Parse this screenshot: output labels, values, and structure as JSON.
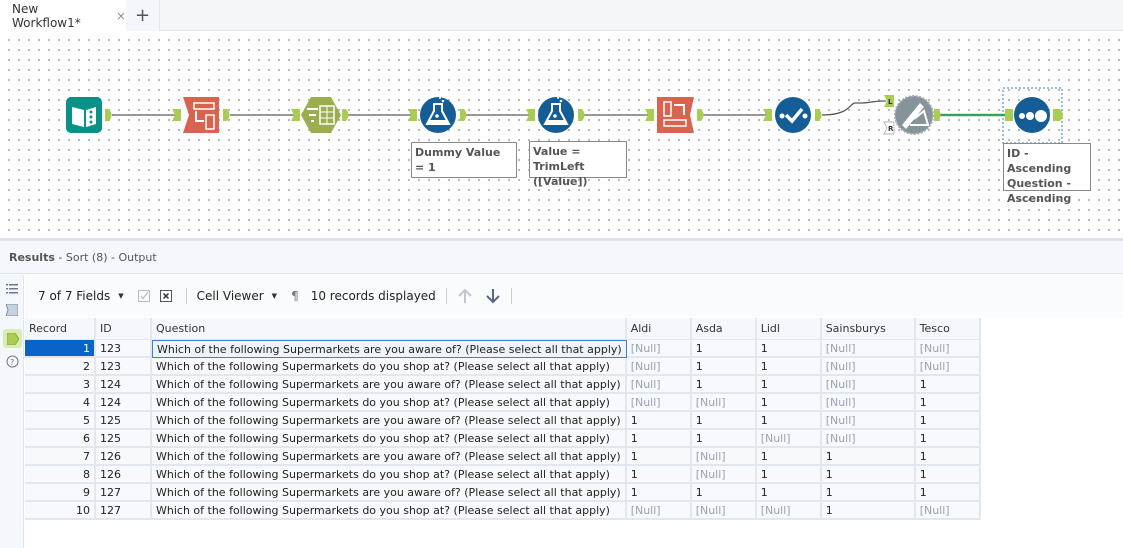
{
  "tabs": [
    {
      "label": "New Workflow1*",
      "close_icon": "×"
    }
  ],
  "add_tab_icon": "+",
  "workflow": {
    "tools": [
      {
        "name": "input-data-tool",
        "color": "#0a9187"
      },
      {
        "name": "transpose-tool",
        "color": "#d9634e"
      },
      {
        "name": "filter-tool",
        "color": "#9bad4c"
      },
      {
        "name": "formula-tool-1",
        "color": "#145d97",
        "annotation": "Dummy Value = 1"
      },
      {
        "name": "formula-tool-2",
        "color": "#145d97",
        "annotation": "Value = TrimLeft ([Value])"
      },
      {
        "name": "crosstab-tool",
        "color": "#d9634e"
      },
      {
        "name": "select-tool",
        "color": "#145d97"
      },
      {
        "name": "join-tool-disabled",
        "color": "#87939a",
        "anchors": [
          "L",
          "R"
        ]
      },
      {
        "name": "sort-tool",
        "color": "#145d97",
        "annotation": "ID - Ascending Question - Ascending"
      }
    ],
    "annotations": {
      "formula1": "Dummy Value = 1",
      "formula2_line1": "Value = TrimLeft",
      "formula2_line2": "([Value])",
      "sort_line1": "ID - Ascending",
      "sort_line2": "Question -",
      "sort_line3": "Ascending"
    },
    "anchor_labels": {
      "left": "L",
      "right": "R"
    }
  },
  "results": {
    "title": "Results",
    "subtitle": " - Sort (8) - Output"
  },
  "toolbar": {
    "fields": "7 of 7 Fields",
    "cell_viewer": "Cell Viewer",
    "records_displayed": "10 records displayed",
    "pilcrow": "¶"
  },
  "table": {
    "columns": [
      "Record",
      "ID",
      "Question",
      "Aldi",
      "Asda",
      "Lidl",
      "Sainsburys",
      "Tesco"
    ],
    "rows": [
      [
        "1",
        "123",
        "Which of the following Supermarkets are you aware of? (Please select all that apply)",
        "[Null]",
        "1",
        "1",
        "[Null]",
        "[Null]"
      ],
      [
        "2",
        "123",
        "Which of the following Supermarkets do you shop at? (Please select all that apply)",
        "[Null]",
        "1",
        "1",
        "[Null]",
        "[Null]"
      ],
      [
        "3",
        "124",
        "Which of the following Supermarkets are you aware of? (Please select all that apply)",
        "[Null]",
        "1",
        "1",
        "[Null]",
        "1"
      ],
      [
        "4",
        "124",
        "Which of the following Supermarkets do you shop at? (Please select all that apply)",
        "[Null]",
        "[Null]",
        "1",
        "[Null]",
        "1"
      ],
      [
        "5",
        "125",
        "Which of the following Supermarkets are you aware of? (Please select all that apply)",
        "1",
        "1",
        "1",
        "[Null]",
        "1"
      ],
      [
        "6",
        "125",
        "Which of the following Supermarkets do you shop at? (Please select all that apply)",
        "1",
        "1",
        "[Null]",
        "[Null]",
        "1"
      ],
      [
        "7",
        "126",
        "Which of the following Supermarkets are you aware of? (Please select all that apply)",
        "1",
        "[Null]",
        "1",
        "1",
        "1"
      ],
      [
        "8",
        "126",
        "Which of the following Supermarkets do you shop at? (Please select all that apply)",
        "1",
        "[Null]",
        "1",
        "1",
        "1"
      ],
      [
        "9",
        "127",
        "Which of the following Supermarkets are you aware of? (Please select all that apply)",
        "1",
        "1",
        "1",
        "1",
        "1"
      ],
      [
        "10",
        "127",
        "Which of the following Supermarkets do you shop at? (Please select all that apply)",
        "[Null]",
        "[Null]",
        "[Null]",
        "1",
        "[Null]"
      ]
    ],
    "selected_row": 0
  }
}
